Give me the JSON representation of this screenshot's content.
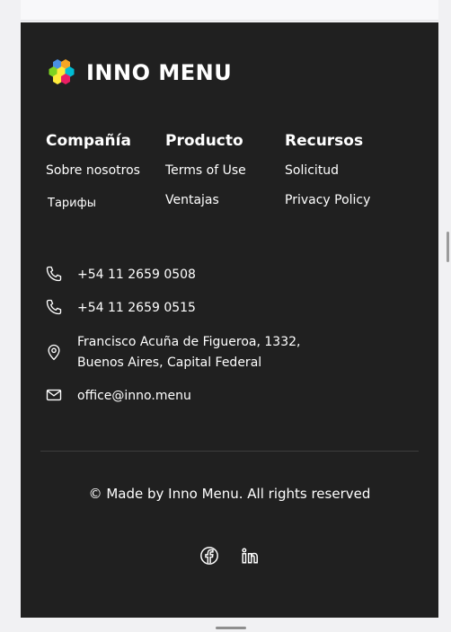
{
  "brand": {
    "name": "INNO MENU"
  },
  "columns": [
    {
      "heading": "Compañía",
      "links": [
        "Sobre nosotros",
        "Тарифы"
      ]
    },
    {
      "heading": "Producto",
      "links": [
        "Terms of Use",
        "Ventajas"
      ]
    },
    {
      "heading": "Recursos",
      "links": [
        "Solicitud",
        "Privacy Policy"
      ]
    }
  ],
  "contacts": {
    "phone1": "+54 11 2659 0508",
    "phone2": "+54 11 2659 0515",
    "address_line1": "Francisco Acuña de Figueroa, 1332,",
    "address_line2": "Buenos Aires, Capital Federal",
    "email": "office@inno.menu"
  },
  "copyright": "© Made by Inno Menu. All rights reserved",
  "social": [
    "facebook-icon",
    "linkedin-icon"
  ],
  "colors": {
    "footer_bg": "#202020",
    "page_bg": "#f1f1f3",
    "logo_hex": [
      "#f5a623",
      "#7ed321",
      "#4a90e2",
      "#e91e63",
      "#ffeb3b",
      "#00bcd4",
      "#8bc34a"
    ]
  }
}
